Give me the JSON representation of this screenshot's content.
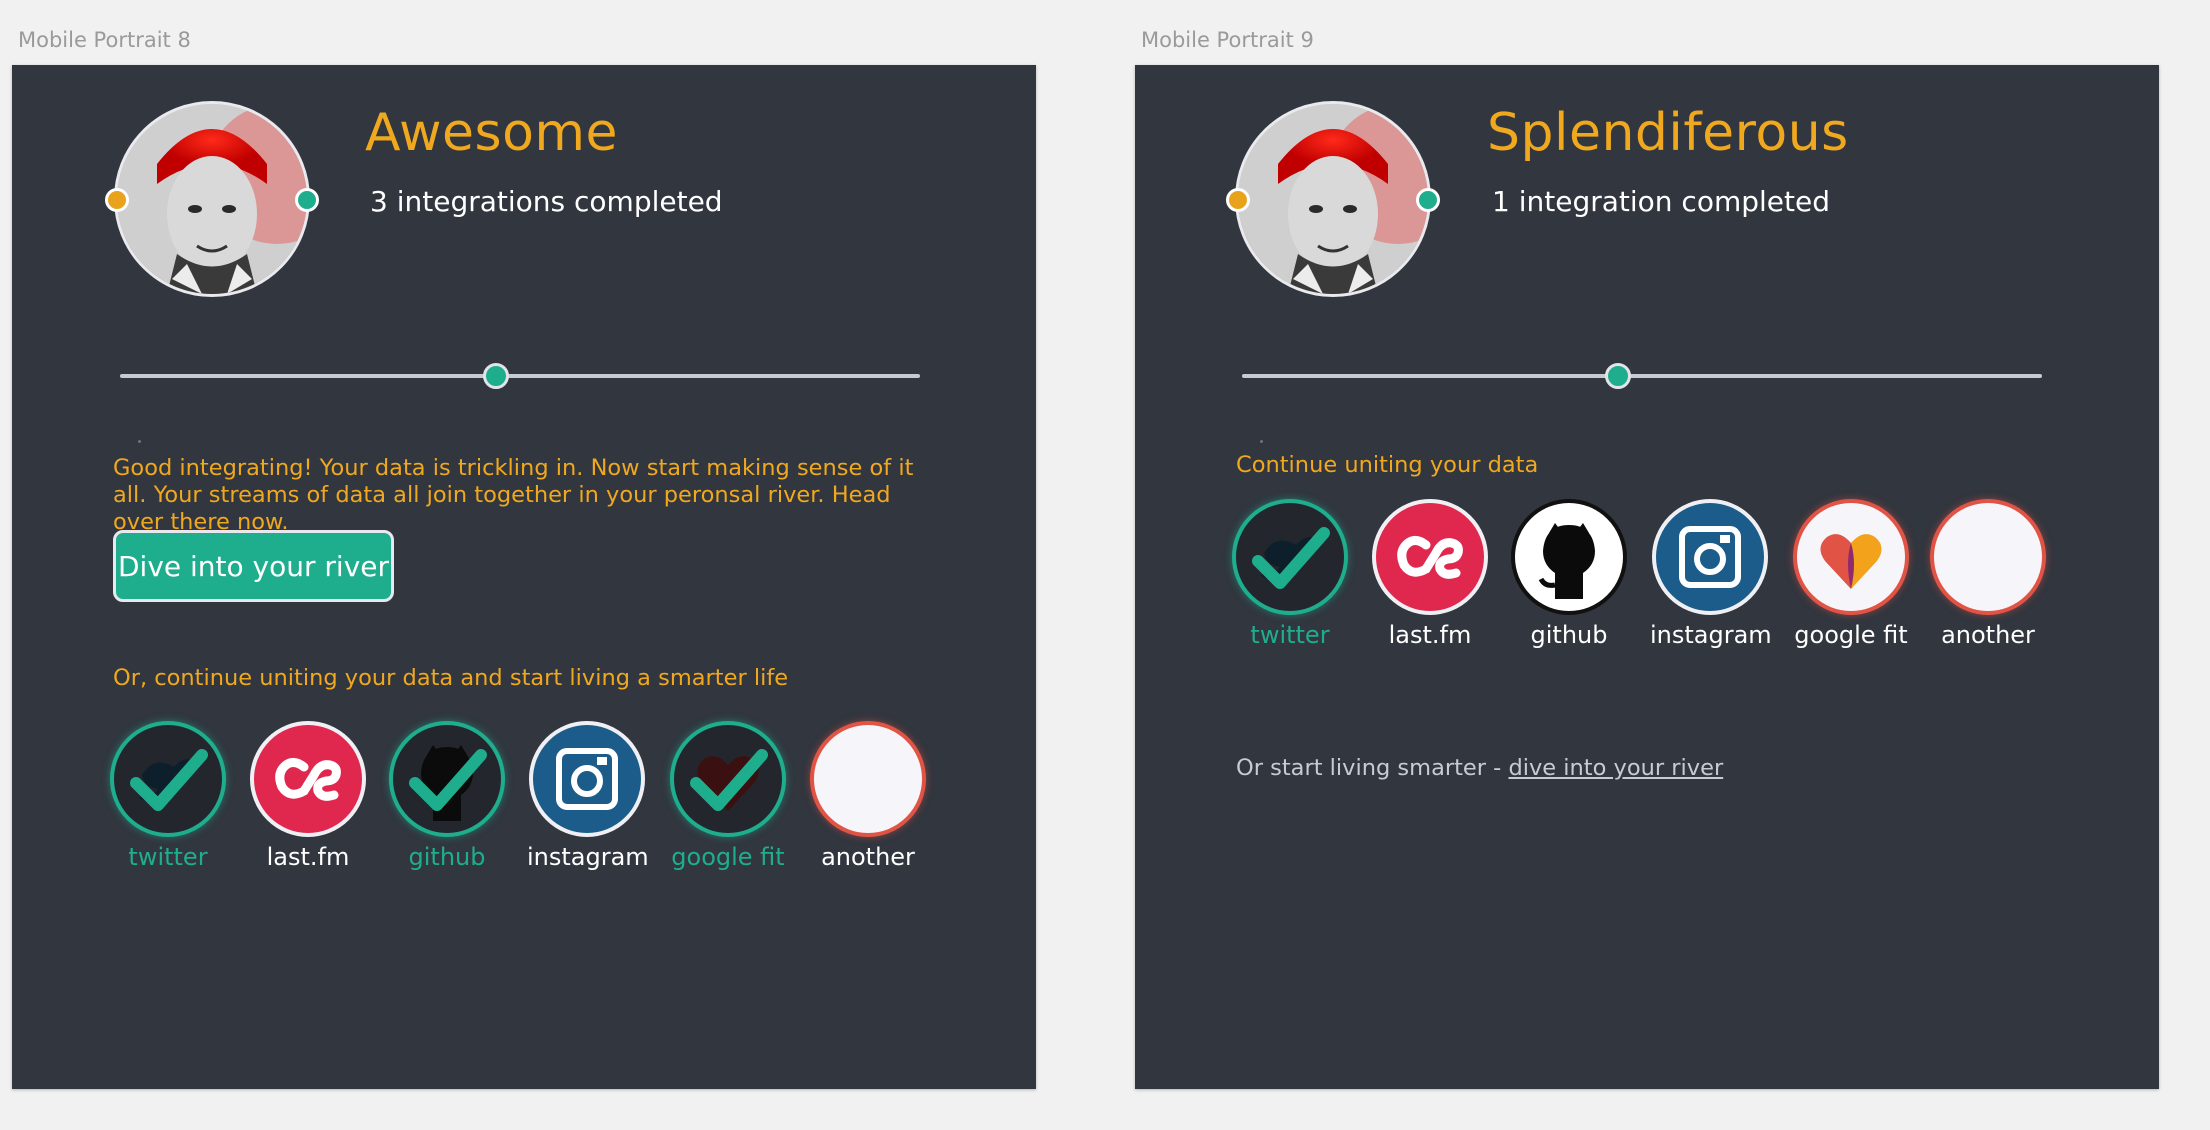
{
  "artboard8": {
    "name": "Mobile Portrait 8",
    "title": "Awesome",
    "subtitle": "3 integrations completed",
    "progress": 0.47,
    "message": "Good integrating! Your data is trickling in. Now start making sense of it all. Your streams of data all join together in your peronsal river. Head over there now.",
    "button_label": "Dive into your river",
    "continue_label": "Or, continue uniting your data and start living a smarter life",
    "integrations": [
      {
        "label": "twitter",
        "state": "done"
      },
      {
        "label": "last.fm",
        "state": "open"
      },
      {
        "label": "github",
        "state": "done"
      },
      {
        "label": "instagram",
        "state": "open"
      },
      {
        "label": "google fit",
        "state": "done"
      },
      {
        "label": "another",
        "state": "open"
      }
    ]
  },
  "artboard9": {
    "name": "Mobile Portrait 9",
    "title": "Splendiferous",
    "subtitle": "1 integration completed",
    "progress": 0.47,
    "continue_label": "Continue uniting your data",
    "integrations": [
      {
        "label": "twitter",
        "state": "done"
      },
      {
        "label": "last.fm",
        "state": "open"
      },
      {
        "label": "github",
        "state": "open"
      },
      {
        "label": "instagram",
        "state": "open"
      },
      {
        "label": "google fit",
        "state": "open"
      },
      {
        "label": "another",
        "state": "open"
      }
    ],
    "footer_prefix": "Or start living smarter - ",
    "footer_link": "dive into your river"
  },
  "colors": {
    "background": "#31363f",
    "accent_orange": "#f0a81e",
    "accent_teal": "#1fae8d",
    "lastfm_red": "#e0284e",
    "instagram_blue": "#1b5c8a"
  },
  "icons": {
    "twitter": "bird-icon",
    "lastfm": "lastfm-icon",
    "github": "octocat-icon",
    "instagram": "camera-icon",
    "google_fit": "heart-icon",
    "check": "checkmark-icon"
  }
}
